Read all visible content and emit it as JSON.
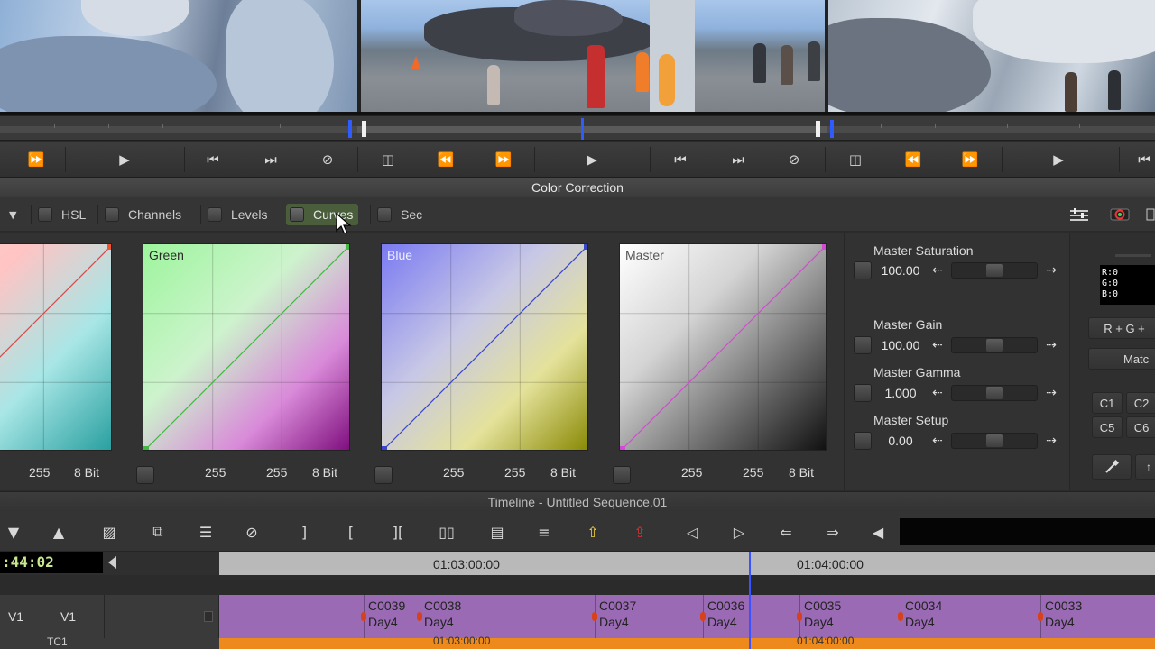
{
  "panel": {
    "title": "Color Correction"
  },
  "tabs": [
    {
      "label": "HSL"
    },
    {
      "label": "Channels"
    },
    {
      "label": "Levels"
    },
    {
      "label": "Curves"
    },
    {
      "label": "Sec"
    }
  ],
  "curves": [
    {
      "name": "",
      "vals": [
        "255",
        "8 Bit"
      ]
    },
    {
      "name": "Green",
      "vals": [
        "255",
        "255",
        "8 Bit"
      ]
    },
    {
      "name": "Blue",
      "vals": [
        "255",
        "255",
        "8 Bit"
      ]
    },
    {
      "name": "Master",
      "vals": [
        "255",
        "255",
        "8 Bit"
      ]
    }
  ],
  "master_controls": [
    {
      "label": "Master Saturation",
      "value": "100.00",
      "level": 0.5
    },
    {
      "label": "Master Gain",
      "value": "100.00",
      "level": 0.5
    },
    {
      "label": "Master Gamma",
      "value": "1.000",
      "level": 0.5
    },
    {
      "label": "Master Setup",
      "value": "0.00",
      "level": 0.5
    }
  ],
  "right_panel": {
    "rgb_readout": [
      "R:0",
      "G:0",
      "B:0"
    ],
    "rg_button": "R + G +",
    "match_button": "Matc",
    "c_buttons": [
      "C1",
      "C2",
      "C5",
      "C6"
    ]
  },
  "timeline": {
    "title": "Timeline - Untitled Sequence.01",
    "timecode": ":44:02",
    "ruler_labels": [
      "01:03:00:00",
      "01:04:00:00"
    ],
    "track_labels": [
      "V1",
      "V1"
    ],
    "tc_track": "TC1",
    "clips": [
      {
        "name": "C0039",
        "sub": "Day4"
      },
      {
        "name": "C0038",
        "sub": "Day4"
      },
      {
        "name": "C0037",
        "sub": "Day4"
      },
      {
        "name": "C0036",
        "sub": "Day4"
      },
      {
        "name": "C0035",
        "sub": "Day4"
      },
      {
        "name": "C0034",
        "sub": "Day4"
      },
      {
        "name": "C0033",
        "sub": "Day4"
      }
    ],
    "tc_labels": [
      "01:03:00:00",
      "01:04:00:00"
    ]
  },
  "colors": {
    "accent_blue": "#2f5cff",
    "clip_purple": "#9a6bb4",
    "tc_orange": "#ee8a1c",
    "timecode_green": "#c7e88e",
    "active_tab": "#4b5e3c"
  }
}
